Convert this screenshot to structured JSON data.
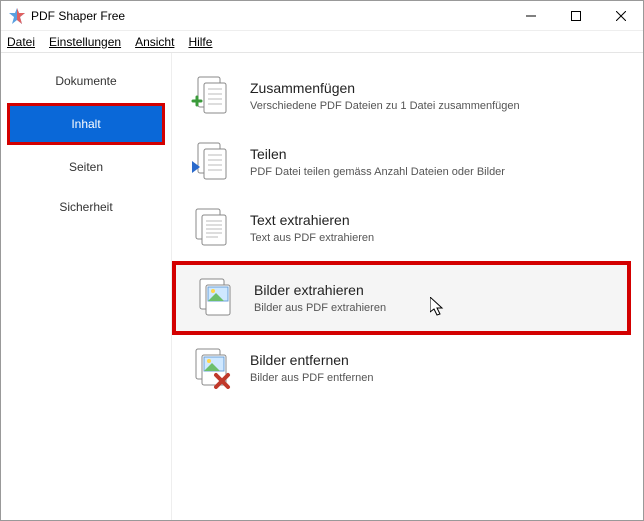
{
  "window": {
    "title": "PDF Shaper Free"
  },
  "menu": {
    "items": [
      "Datei",
      "Einstellungen",
      "Ansicht",
      "Hilfe"
    ]
  },
  "sidebar": {
    "items": [
      {
        "label": "Dokumente",
        "selected": false
      },
      {
        "label": "Inhalt",
        "selected": true
      },
      {
        "label": "Seiten",
        "selected": false
      },
      {
        "label": "Sicherheit",
        "selected": false
      }
    ]
  },
  "actions": [
    {
      "title": "Zusammenfügen",
      "desc": "Verschiedene PDF Dateien zu 1 Datei zusammenfügen",
      "icon": "merge"
    },
    {
      "title": "Teilen",
      "desc": "PDF Datei teilen gemäss Anzahl Dateien oder Bilder",
      "icon": "split"
    },
    {
      "title": "Text extrahieren",
      "desc": "Text aus PDF extrahieren",
      "icon": "text"
    },
    {
      "title": "Bilder extrahieren",
      "desc": "Bilder aus PDF extrahieren",
      "icon": "imgext",
      "highlight": true
    },
    {
      "title": "Bilder entfernen",
      "desc": "Bilder aus PDF entfernen",
      "icon": "imgdel"
    }
  ]
}
